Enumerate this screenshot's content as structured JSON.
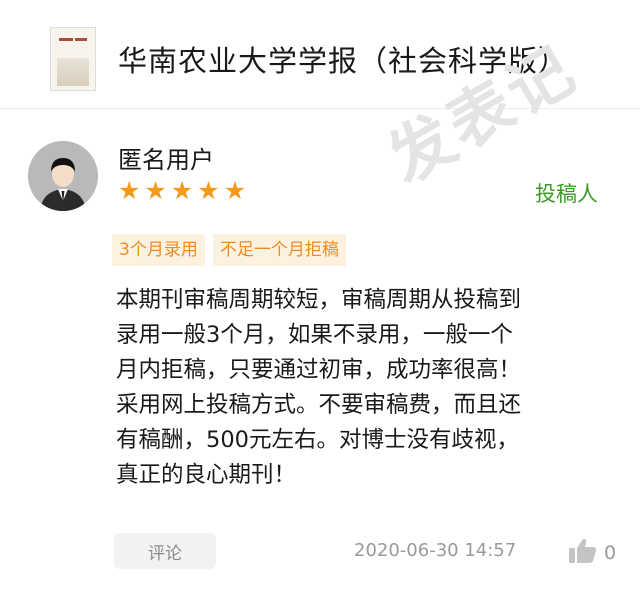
{
  "header": {
    "journal_title": "华南农业大学学报（社会科学版）",
    "cover_icon": "journal-cover-thumbnail"
  },
  "review": {
    "user_name": "匿名用户",
    "avatar_icon": "anonymous-user-avatar",
    "rating": 5,
    "rating_max": 5,
    "role": "投稿人",
    "watermark": "发表记",
    "tags": [
      "3个月录用",
      "不足一个月拒稿"
    ],
    "body_lines": [
      "本期刊审稿周期较短，审稿周期从投稿到",
      "录用一般3个月，如果不录用，一般一个",
      "月内拒稿，只要通过初审，成功率很高！",
      "采用网上投稿方式。不要审稿费，而且还",
      "有稿酬，500元左右。对博士没有歧视，",
      "真正的良心期刊！"
    ],
    "timestamp": "2020-06-30 14:57",
    "like_count": "0"
  },
  "actions": {
    "comment_label": "评论"
  },
  "colors": {
    "star": "#f39a1d",
    "role_text": "#3d9a2a",
    "tag_bg": "#fdf1df",
    "tag_text": "#ef8c24",
    "watermark": "#e4e4e4"
  }
}
